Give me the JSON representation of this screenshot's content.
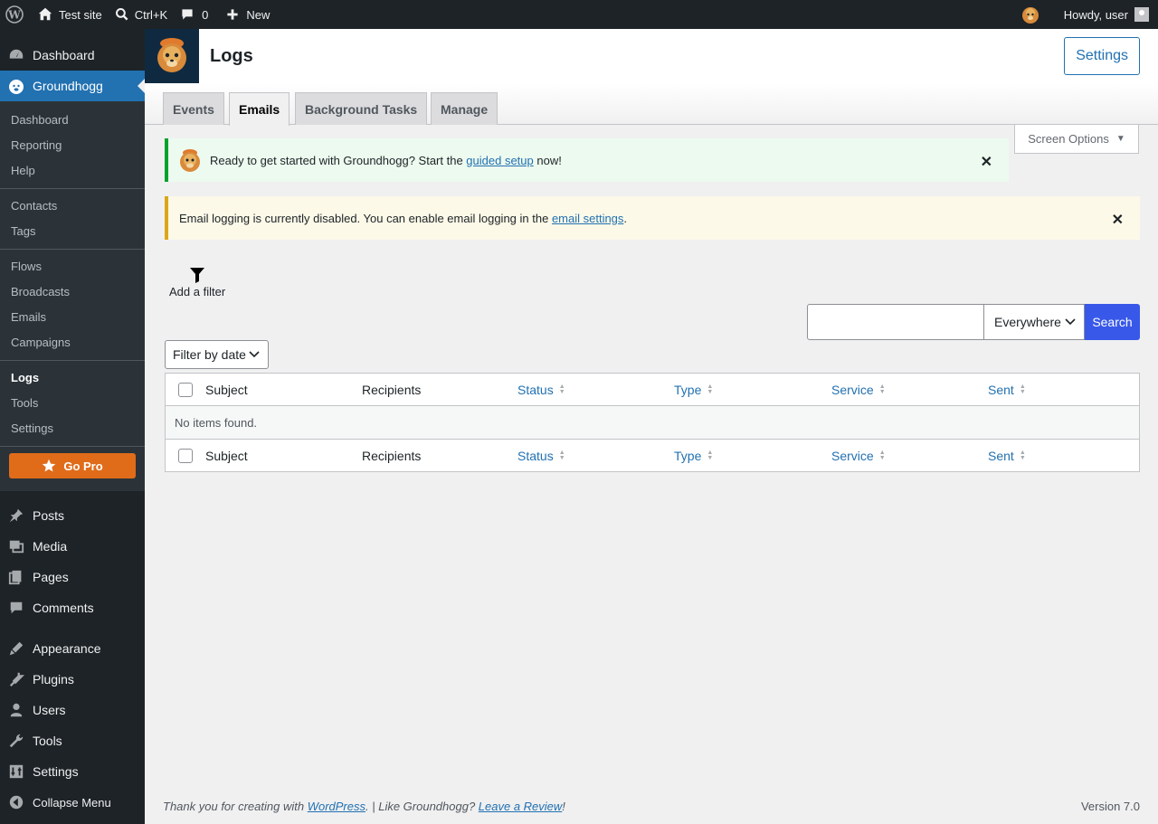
{
  "admin_bar": {
    "site_name": "Test site",
    "search_shortcut": "Ctrl+K",
    "comments_count": "0",
    "new_label": "New",
    "greeting": "Howdy, user"
  },
  "sidebar": {
    "top_items": [
      {
        "label": "Dashboard",
        "icon": "dashboard-icon"
      },
      {
        "label": "Groundhogg",
        "icon": "groundhogg-icon"
      }
    ],
    "submenu": {
      "group1": [
        "Dashboard",
        "Reporting",
        "Help"
      ],
      "group2": [
        "Contacts",
        "Tags"
      ],
      "group3": [
        "Flows",
        "Broadcasts",
        "Emails",
        "Campaigns"
      ],
      "group4": [
        "Logs",
        "Tools",
        "Settings"
      ],
      "go_pro": "Go Pro"
    },
    "bottom_items": [
      {
        "label": "Posts",
        "icon": "pin-icon"
      },
      {
        "label": "Media",
        "icon": "media-icon"
      },
      {
        "label": "Pages",
        "icon": "pages-icon"
      },
      {
        "label": "Comments",
        "icon": "comment-icon"
      },
      {
        "label": "Appearance",
        "icon": "brush-icon"
      },
      {
        "label": "Plugins",
        "icon": "plugin-icon"
      },
      {
        "label": "Users",
        "icon": "user-icon"
      },
      {
        "label": "Tools",
        "icon": "wrench-icon"
      },
      {
        "label": "Settings",
        "icon": "settings-icon"
      },
      {
        "label": "Collapse Menu",
        "icon": "collapse-icon"
      }
    ]
  },
  "header": {
    "title": "Logs",
    "settings_label": "Settings"
  },
  "tabs": [
    "Events",
    "Emails",
    "Background Tasks",
    "Manage"
  ],
  "active_tab": "Emails",
  "screen_options": "Screen Options",
  "notices": {
    "setup": {
      "before": "Ready to get started with Groundhogg? Start the ",
      "link": "guided setup",
      "after": " now!"
    },
    "logging": {
      "before": "Email logging is currently disabled. You can enable email logging in the ",
      "link": "email settings",
      "after": "."
    }
  },
  "filter": {
    "add_filter": "Add a filter",
    "search_scope": "Everywhere",
    "search_button": "Search",
    "search_value": "",
    "date_filter": "Filter by date"
  },
  "table": {
    "columns": [
      "Subject",
      "Recipients",
      "Status",
      "Type",
      "Service",
      "Sent"
    ],
    "empty_message": "No items found."
  },
  "footer": {
    "thanks_before": "Thank you for creating with ",
    "wordpress_link": "WordPress",
    "thanks_middle": ". | Like Groundhogg? ",
    "review_link": "Leave a Review",
    "thanks_after": "!",
    "version": "Version 7.0"
  },
  "colors": {
    "accent": "#2271b1",
    "search_button": "#3858e9",
    "go_pro": "#e06c1a",
    "success": "#00a32a",
    "warning": "#dba617"
  }
}
